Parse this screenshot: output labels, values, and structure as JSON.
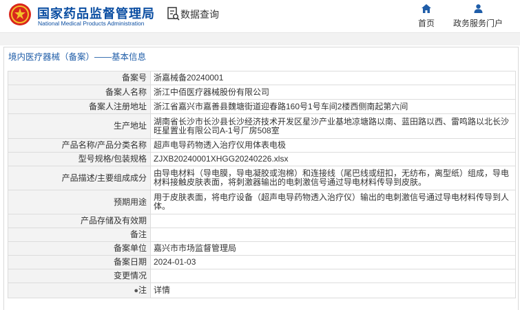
{
  "header": {
    "brand_cn": "国家药品监督管理局",
    "brand_en": "National Medical Products Administration",
    "query_label": "数据查询",
    "nav": [
      {
        "label": "首页",
        "icon": "home-icon"
      },
      {
        "label": "政务服务门户",
        "icon": "user-icon"
      }
    ]
  },
  "panel": {
    "title": "境内医疗器械（备案）——基本信息"
  },
  "rows": [
    {
      "label": "备案号",
      "value": "浙嘉械备20240001"
    },
    {
      "label": "备案人名称",
      "value": "浙江中佰医疗器械股份有限公司"
    },
    {
      "label": "备案人注册地址",
      "value": "浙江省嘉兴市嘉善县魏塘街道迎春路160号1号车间2楼西侧南起第六间"
    },
    {
      "label": "生产地址",
      "value": "湖南省长沙市长沙县长沙经济技术开发区星沙产业基地凉塘路以南、蓝田路以西、雷鸣路以北长沙旺星置业有限公司A-1号厂房508室"
    },
    {
      "label": "产品名称/产品分类名称",
      "value": "超声电导药物透入治疗仪用体表电极"
    },
    {
      "label": "型号规格/包装规格",
      "value": "ZJXB20240001XHGG20240226.xlsx"
    },
    {
      "label": "产品描述/主要组成成分",
      "value": "由导电材料（导电膜，导电凝胶或泡棉）和连接线（尾巴线或纽扣，无纺布，离型纸）组成，导电材料接触皮肤表面，将刺激器输出的电刺激信号通过导电材料传导到皮肤。"
    },
    {
      "label": "预期用途",
      "value": "用于皮肤表面，将电疗设备（超声电导药物透入治疗仪）输出的电刺激信号通过导电材料传导到人体。"
    },
    {
      "label": "产品存储及有效期",
      "value": ""
    },
    {
      "label": "备注",
      "value": ""
    },
    {
      "label": "备案单位",
      "value": "嘉兴市市场监督管理局"
    },
    {
      "label": "备案日期",
      "value": "2024-01-03"
    },
    {
      "label": "变更情况",
      "value": ""
    }
  ],
  "note": {
    "label": "注",
    "icon": "lightbulb-icon",
    "link": "详情"
  },
  "colors": {
    "brand_blue": "#0b4ea2",
    "link_blue": "#2b6cc4",
    "label_bg": "#f3f3f3"
  }
}
